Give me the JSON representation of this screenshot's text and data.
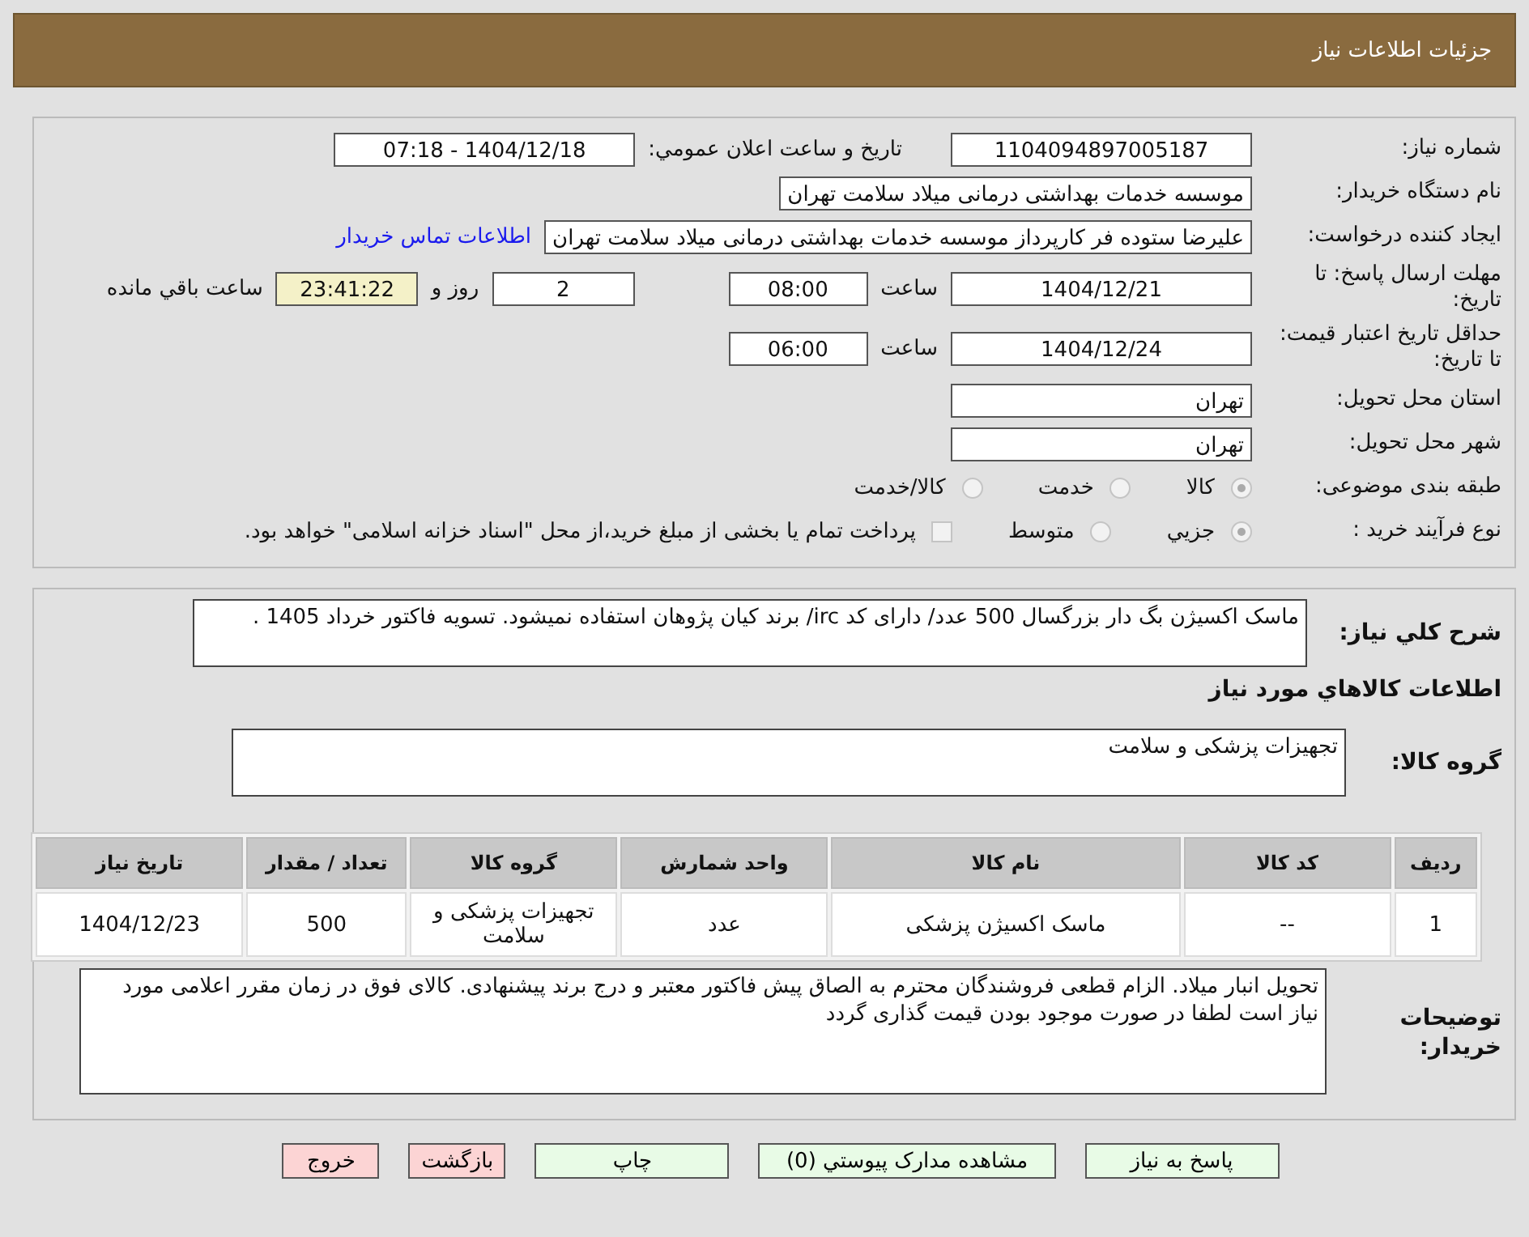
{
  "header": {
    "title": "جزئیات اطلاعات نیاز"
  },
  "need_number": {
    "label": "شماره نیاز:",
    "value": "1104094897005187"
  },
  "announce": {
    "label": "تاریخ و ساعت اعلان عمومي:",
    "value": "1404/12/18 - 07:18"
  },
  "buyer": {
    "label": "نام دستگاه خریدار:",
    "value": "موسسه خدمات بهداشتی درمانی میلاد سلامت تهران"
  },
  "requester": {
    "label": "ایجاد کننده درخواست:",
    "value": "علیرضا ستوده فر کارپرداز موسسه خدمات بهداشتی درمانی میلاد سلامت تهران",
    "link": "اطلاعات تماس خریدار"
  },
  "deadline": {
    "label": "مهلت ارسال پاسخ: تا تاریخ:",
    "date": "1404/12/21",
    "time_label": "ساعت",
    "time": "08:00",
    "days": "2",
    "days_label": "روز و",
    "remaining": "23:41:22",
    "remaining_label": "ساعت باقي مانده"
  },
  "validity": {
    "label": "حداقل تاریخ اعتبار قیمت: تا تاریخ:",
    "date": "1404/12/24",
    "time_label": "ساعت",
    "time": "06:00"
  },
  "province": {
    "label": "استان محل تحویل:",
    "value": "تهران"
  },
  "city": {
    "label": "شهر محل تحویل:",
    "value": "تهران"
  },
  "category": {
    "label": "طبقه بندی موضوعی:",
    "options": [
      {
        "label": "کالا",
        "selected": true
      },
      {
        "label": "خدمت",
        "selected": false
      },
      {
        "label": "کالا/خدمت",
        "selected": false
      }
    ]
  },
  "process": {
    "label": "نوع فرآیند خرید :",
    "options": [
      {
        "label": "جزيي",
        "selected": true
      },
      {
        "label": "متوسط",
        "selected": false
      }
    ],
    "payment": {
      "checked": false,
      "text": "پرداخت تمام یا بخشی از مبلغ خرید،از محل \"اسناد خزانه اسلامی\" خواهد بود."
    }
  },
  "description": {
    "label": "شرح کلي نیاز:",
    "value": "ماسک اکسیژن بگ دار بزرگسال 500 عدد/ دارای کد irc/ برند کیان پژوهان  استفاده نمیشود. تسویه فاکتور خرداد 1405 ."
  },
  "goods_heading": "اطلاعات کالاهاي مورد نیاز",
  "goods_group": {
    "label": "گروه کالا:",
    "value": "تجهیزات پزشکی و سلامت"
  },
  "table": {
    "columns": [
      "ردیف",
      "کد کالا",
      "نام کالا",
      "واحد شمارش",
      "گروه کالا",
      "تعداد / مقدار",
      "تاریخ نیاز"
    ],
    "rows": [
      [
        "1",
        "--",
        "ماسک اکسیژن پزشکی",
        "عدد",
        "تجهیزات پزشکی و سلامت",
        "500",
        "1404/12/23"
      ]
    ]
  },
  "notes": {
    "label": "توضیحات خریدار:",
    "value": "تحویل انبار میلاد. الزام قطعی فروشندگان محترم به الصاق پیش فاکتور معتبر و درج برند پیشنهادی. کالای فوق در زمان مقرر اعلامی مورد نیاز است لطفا در صورت موجود بودن قیمت گذاری گردد"
  },
  "buttons": [
    {
      "label": "پاسخ به نیاز",
      "kind": "primary"
    },
    {
      "label": "مشاهده مدارک پیوستي (0)",
      "kind": "primary"
    },
    {
      "label": "چاپ",
      "kind": "primary"
    },
    {
      "label": "بازگشت",
      "kind": "danger"
    },
    {
      "label": "خروج",
      "kind": "danger"
    }
  ]
}
